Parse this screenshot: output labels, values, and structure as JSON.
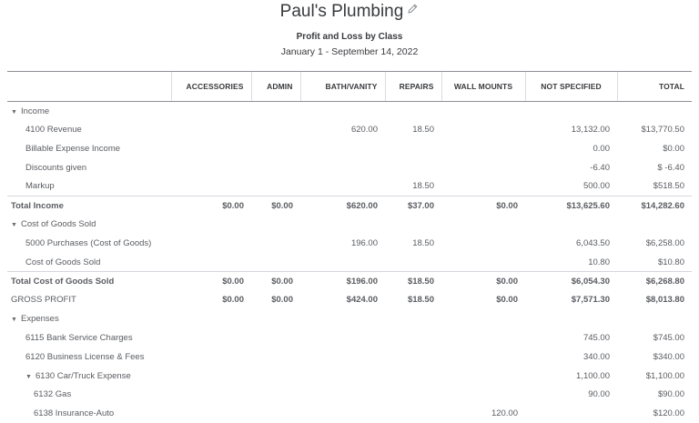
{
  "company": {
    "name": "Paul's Plumbing",
    "edit_icon": "pencil-icon"
  },
  "report": {
    "title": "Profit and Loss by Class",
    "dates": "January 1 - September 14, 2022"
  },
  "columns": [
    "",
    "ACCESSORIES",
    "ADMIN",
    "BATH/VANITY",
    "REPAIRS",
    "WALL MOUNTS",
    "NOT SPECIFIED",
    "TOTAL"
  ],
  "rows": [
    {
      "type": "section",
      "level": 0,
      "expand_icon": "caret-down-icon",
      "cells": [
        "Income",
        "",
        "",
        "",
        "",
        "",
        "",
        ""
      ]
    },
    {
      "type": "account",
      "level": 1,
      "cells": [
        "4100 Revenue",
        "",
        "",
        "620.00",
        "18.50",
        "",
        "13,132.00",
        "$13,770.50"
      ]
    },
    {
      "type": "account",
      "level": 1,
      "cells": [
        "Billable Expense Income",
        "",
        "",
        "",
        "",
        "",
        "0.00",
        "$0.00"
      ]
    },
    {
      "type": "account",
      "level": 1,
      "cells": [
        "Discounts given",
        "",
        "",
        "",
        "",
        "",
        "-6.40",
        "$ -6.40"
      ]
    },
    {
      "type": "account",
      "level": 1,
      "cells": [
        "Markup",
        "",
        "",
        "",
        "18.50",
        "",
        "500.00",
        "$518.50"
      ]
    },
    {
      "type": "total",
      "level": 0,
      "cells": [
        "Total Income",
        "$0.00",
        "$0.00",
        "$620.00",
        "$37.00",
        "$0.00",
        "$13,625.60",
        "$14,282.60"
      ]
    },
    {
      "type": "section",
      "level": 0,
      "expand_icon": "caret-down-icon",
      "cells": [
        "Cost of Goods Sold",
        "",
        "",
        "",
        "",
        "",
        "",
        ""
      ]
    },
    {
      "type": "account",
      "level": 1,
      "cells": [
        "5000 Purchases (Cost of Goods)",
        "",
        "",
        "196.00",
        "18.50",
        "",
        "6,043.50",
        "$6,258.00"
      ]
    },
    {
      "type": "account",
      "level": 1,
      "cells": [
        "Cost of Goods Sold",
        "",
        "",
        "",
        "",
        "",
        "10.80",
        "$10.80"
      ]
    },
    {
      "type": "total",
      "level": 0,
      "cells": [
        "Total Cost of Goods Sold",
        "$0.00",
        "$0.00",
        "$196.00",
        "$18.50",
        "$0.00",
        "$6,054.30",
        "$6,268.80"
      ]
    },
    {
      "type": "gross",
      "level": 0,
      "cells": [
        "GROSS PROFIT",
        "$0.00",
        "$0.00",
        "$424.00",
        "$18.50",
        "$0.00",
        "$7,571.30",
        "$8,013.80"
      ]
    },
    {
      "type": "section",
      "level": 0,
      "expand_icon": "caret-down-icon",
      "cells": [
        "Expenses",
        "",
        "",
        "",
        "",
        "",
        "",
        ""
      ]
    },
    {
      "type": "account",
      "level": 1,
      "cells": [
        "6115 Bank Service Charges",
        "",
        "",
        "",
        "",
        "",
        "745.00",
        "$745.00"
      ]
    },
    {
      "type": "account",
      "level": 1,
      "cells": [
        "6120 Business License & Fees",
        "",
        "",
        "",
        "",
        "",
        "340.00",
        "$340.00"
      ]
    },
    {
      "type": "section",
      "level": 1,
      "expand_icon": "caret-down-icon",
      "cells": [
        "6130 Car/Truck Expense",
        "",
        "",
        "",
        "",
        "",
        "1,100.00",
        "$1,100.00"
      ]
    },
    {
      "type": "account",
      "level": 2,
      "cells": [
        "6132 Gas",
        "",
        "",
        "",
        "",
        "",
        "90.00",
        "$90.00"
      ]
    },
    {
      "type": "account",
      "level": 2,
      "cells": [
        "6138 Insurance-Auto",
        "",
        "",
        "",
        "",
        "120.00",
        "",
        "$120.00"
      ]
    }
  ]
}
